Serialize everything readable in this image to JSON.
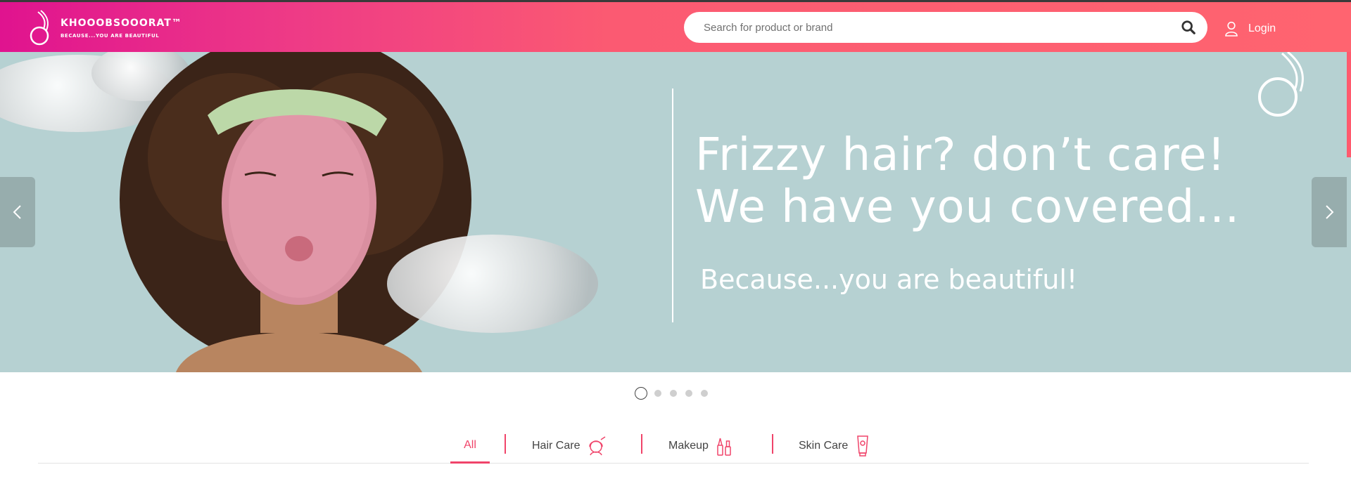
{
  "header": {
    "logo_text": "KHOOOBSOOORAT™",
    "logo_tagline": "BECAUSE...YOU ARE BEAUTIFUL",
    "search_placeholder": "Search for product or brand",
    "login_label": "Login"
  },
  "hero": {
    "title_line1": "Frizzy hair? don’t care!",
    "title_line2": "We have you covered...",
    "subtitle": "Because...you are beautiful!",
    "slide_count": 5,
    "active_slide": 1
  },
  "tabs": [
    {
      "label": "All",
      "active": true,
      "icon": ""
    },
    {
      "label": "Hair Care",
      "active": false,
      "icon": "hair-care-icon"
    },
    {
      "label": "Makeup",
      "active": false,
      "icon": "makeup-icon"
    },
    {
      "label": "Skin Care",
      "active": false,
      "icon": "skin-care-icon"
    }
  ],
  "colors": {
    "brand_pink": "#e0138f",
    "brand_coral": "#ff6470",
    "accent": "#f0446a",
    "hero_bg": "#b6d1d2"
  }
}
